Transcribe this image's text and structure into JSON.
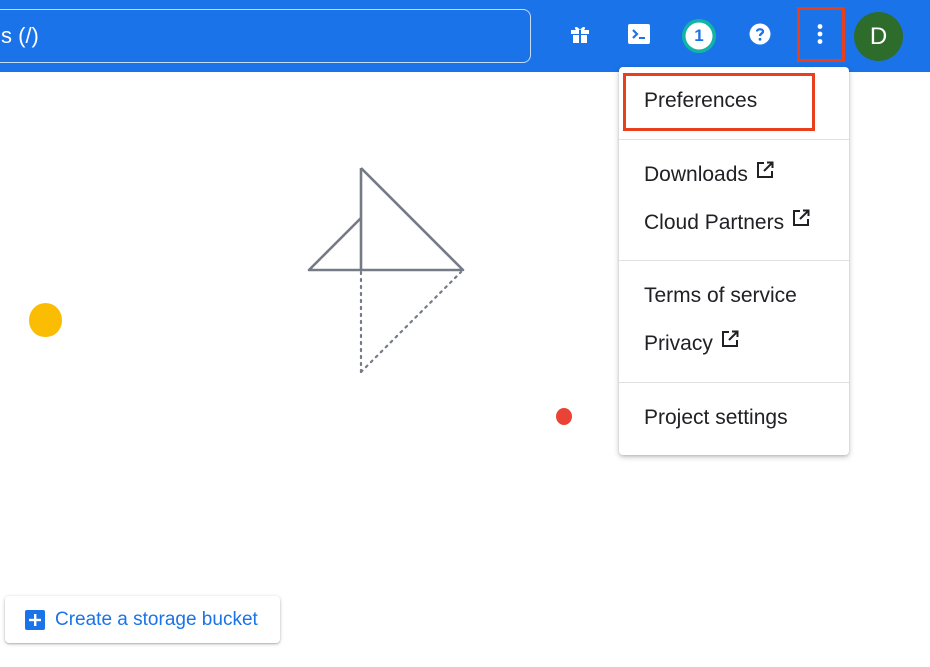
{
  "header": {
    "search_text": "s (/)",
    "avatar_letter": "D",
    "notification_count": "1"
  },
  "menu": {
    "items": [
      {
        "label": "Preferences"
      },
      {
        "label": "Downloads"
      },
      {
        "label": "Cloud Partners"
      },
      {
        "label": "Terms of service"
      },
      {
        "label": "Privacy"
      },
      {
        "label": "Project settings"
      }
    ]
  },
  "main": {
    "create_bucket_label": "Create a storage bucket"
  },
  "colors": {
    "topbar": "#1a73e8",
    "highlight": "#e8401c",
    "avatar": "#2e6c2b",
    "badge_ring": "#12b5a5"
  }
}
